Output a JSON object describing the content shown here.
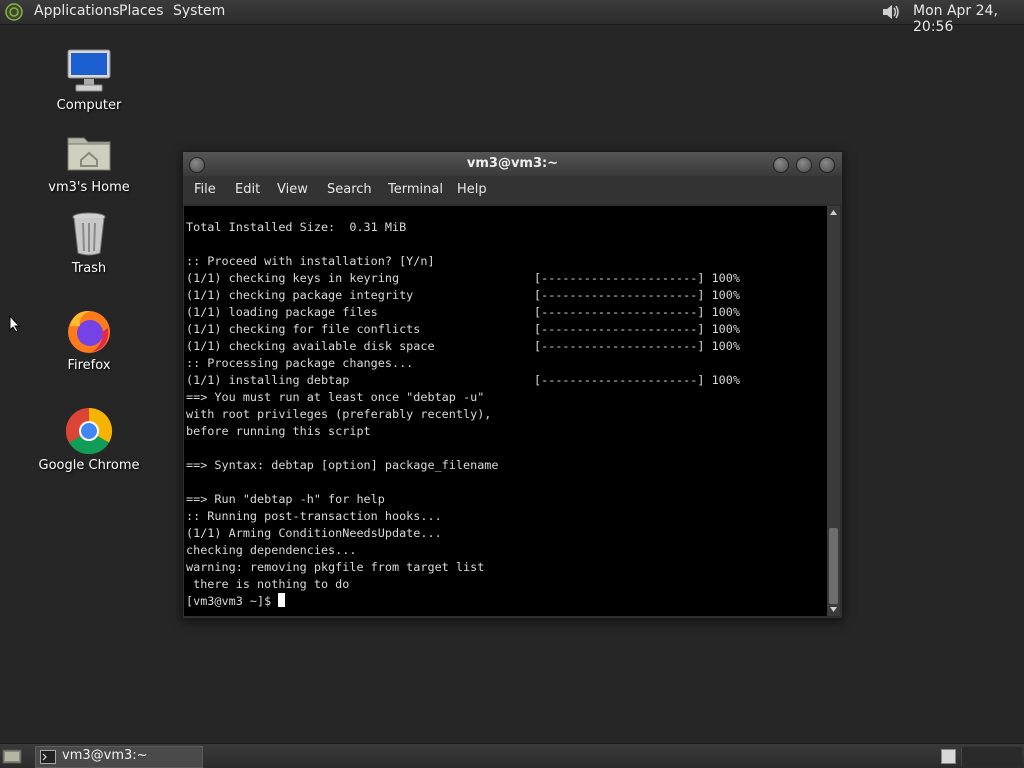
{
  "top_panel": {
    "menus": [
      "Applications",
      "Places",
      "System"
    ],
    "clock": "Mon Apr 24, 20:56",
    "icons": {
      "logo": "distro-logo-icon",
      "volume": "volume-icon"
    }
  },
  "desktop": {
    "icons": [
      {
        "label": "Computer",
        "icon": "computer-icon"
      },
      {
        "label": "vm3's Home",
        "icon": "home-folder-icon"
      },
      {
        "label": "Trash",
        "icon": "trash-icon"
      },
      {
        "label": "Firefox",
        "icon": "firefox-icon"
      },
      {
        "label": "Google Chrome",
        "icon": "chrome-icon"
      }
    ]
  },
  "terminal": {
    "title": "vm3@vm3:~",
    "menus": [
      "File",
      "Edit",
      "View",
      "Search",
      "Terminal",
      "Help"
    ],
    "lines": [
      "Total Installed Size:  0.31 MiB",
      "",
      ":: Proceed with installation? [Y/n]",
      "(1/1) checking keys in keyring                   [----------------------] 100%",
      "(1/1) checking package integrity                 [----------------------] 100%",
      "(1/1) loading package files                      [----------------------] 100%",
      "(1/1) checking for file conflicts                [----------------------] 100%",
      "(1/1) checking available disk space              [----------------------] 100%",
      ":: Processing package changes...",
      "(1/1) installing debtap                          [----------------------] 100%",
      "==> You must run at least once \"debtap -u\"",
      "with root privileges (preferably recently),",
      "before running this script",
      "",
      "==> Syntax: debtap [option] package_filename",
      "",
      "==> Run \"debtap -h\" for help",
      ":: Running post-transaction hooks...",
      "(1/1) Arming ConditionNeedsUpdate...",
      "checking dependencies...",
      "warning: removing pkgfile from target list",
      " there is nothing to do"
    ],
    "prompt": "[vm3@vm3 ~]$ ",
    "scroll_position": 0.95
  },
  "bottom_panel": {
    "task_label": "vm3@vm3:~",
    "workspaces": 2
  },
  "colors": {
    "desktop_bg": "#262626",
    "terminal_bg": "#000000",
    "terminal_fg": "#d9d9d9"
  }
}
